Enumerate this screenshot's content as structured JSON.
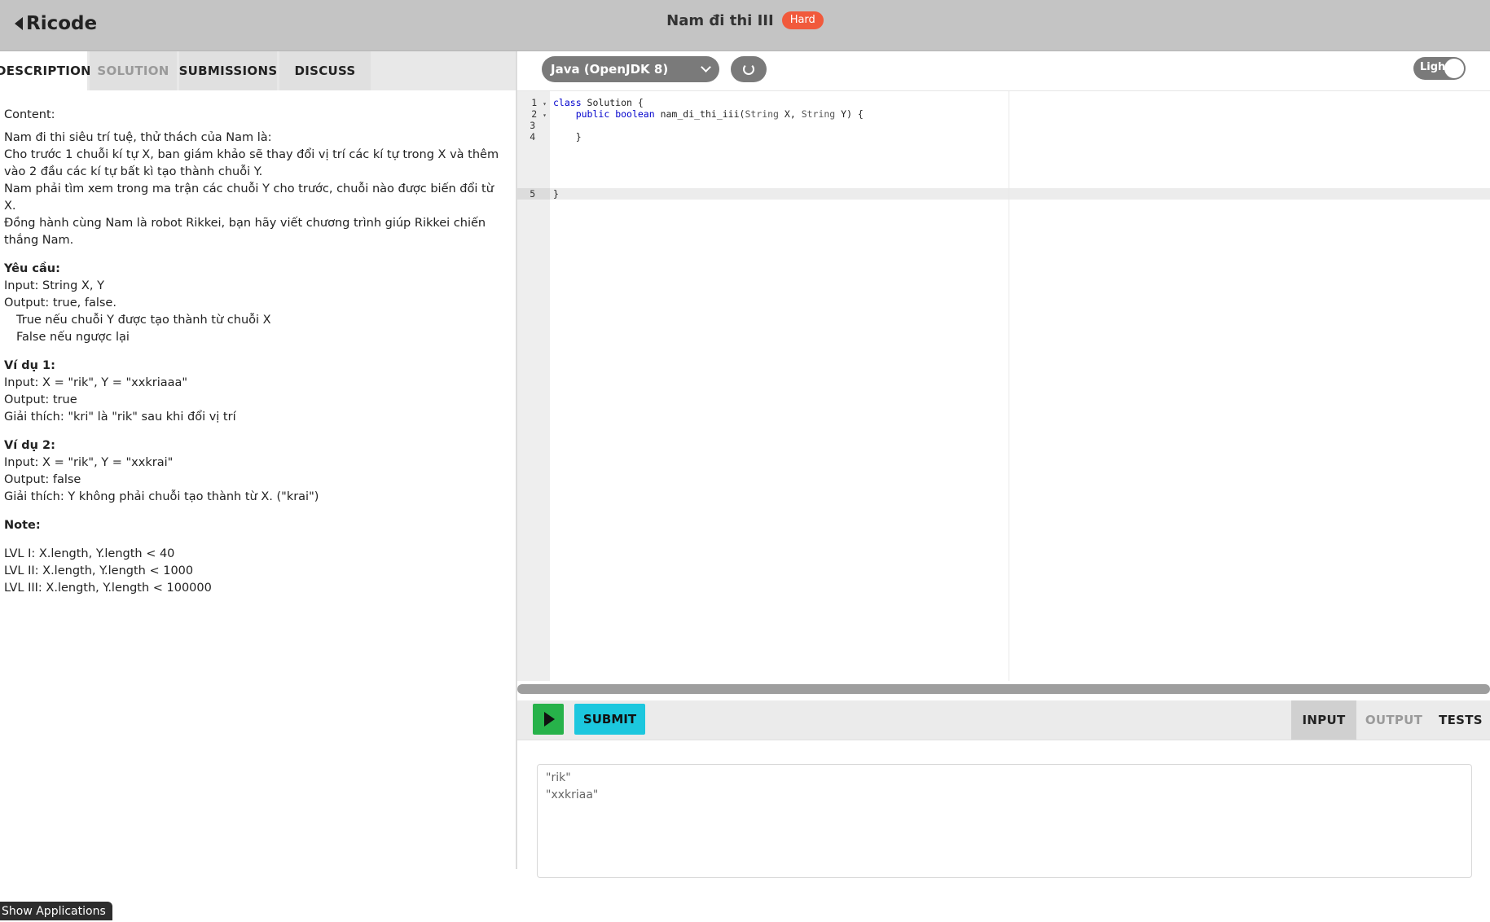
{
  "header": {
    "brand": "Ricode",
    "problem_title": "Nam đi thi III",
    "difficulty": "Hard"
  },
  "left_tabs": [
    "DESCRIPTION",
    "SOLUTION",
    "SUBMISSIONS",
    "DISCUSS"
  ],
  "description": {
    "content_label": "Content:",
    "para1": "Nam đi thi siêu trí tuệ, thử thách của Nam là:",
    "para2": "Cho trước 1 chuỗi kí tự X, ban giám khảo sẽ thay đổi vị trí các kí tự trong X và thêm vào 2 đầu các kí tự bất kì tạo thành chuỗi Y.",
    "para3": "Nam phải tìm xem trong ma trận các chuỗi Y cho trước, chuỗi nào được biến đổi từ X.",
    "para4": "Đồng hành cùng Nam là robot Rikkei, bạn hãy viết chương trình giúp Rikkei chiến thắng Nam.",
    "req_heading": "Yêu cầu:",
    "req_input": "Input: String X, Y",
    "req_output": "Output: true, false.",
    "req_true": "True nếu chuỗi Y được tạo thành từ chuỗi X",
    "req_false": "False nếu ngược lại",
    "ex1_heading": "Ví dụ 1:",
    "ex1_input": "Input: X = \"rik\", Y = \"xxkriaaa\"",
    "ex1_output": "Output: true",
    "ex1_explain": "Giải thích: \"kri\" là \"rik\" sau khi đổi vị trí",
    "ex2_heading": "Ví dụ 2:",
    "ex2_input": "Input: X = \"rik\", Y = \"xxkrai\"",
    "ex2_output": "Output: false",
    "ex2_explain": "Giải thích: Y không phải chuỗi tạo thành từ X. (\"krai\")",
    "note_heading": "Note:",
    "lvl1": "LVL I: X.length, Y.length < 40",
    "lvl2": "LVL II: X.length, Y.length < 1000",
    "lvl3": "LVL III: X.length, Y.length < 100000"
  },
  "taskbar": {
    "show_apps": "Show Applications"
  },
  "toolbar": {
    "language": "Java (OpenJDK 8)",
    "theme_label": "Light"
  },
  "editor": {
    "line_numbers": [
      "1",
      "2",
      "3",
      "4",
      "5"
    ],
    "code": {
      "l1_kw": "class",
      "l1_rest": " Solution {",
      "l2_kw1": "public",
      "l2_kw2": "boolean",
      "l2_name": " nam_di_thi_iii(",
      "l2_t1": "String",
      "l2_p1": " X, ",
      "l2_t2": "String",
      "l2_p2": " Y) {",
      "l4": "    }",
      "l5": "}"
    }
  },
  "bottom": {
    "submit_label": "SUBMIT",
    "io_tabs": [
      "INPUT",
      "OUTPUT",
      "TESTS"
    ],
    "input_lines": [
      "\"rik\"",
      "\"xxkriaa\""
    ]
  },
  "colors": {
    "header_bg": "#c4c4c4",
    "hard_badge": "#f15a3c",
    "run_button": "#27b24a",
    "submit_button": "#1cc7de",
    "keyword": "#0000cc"
  }
}
